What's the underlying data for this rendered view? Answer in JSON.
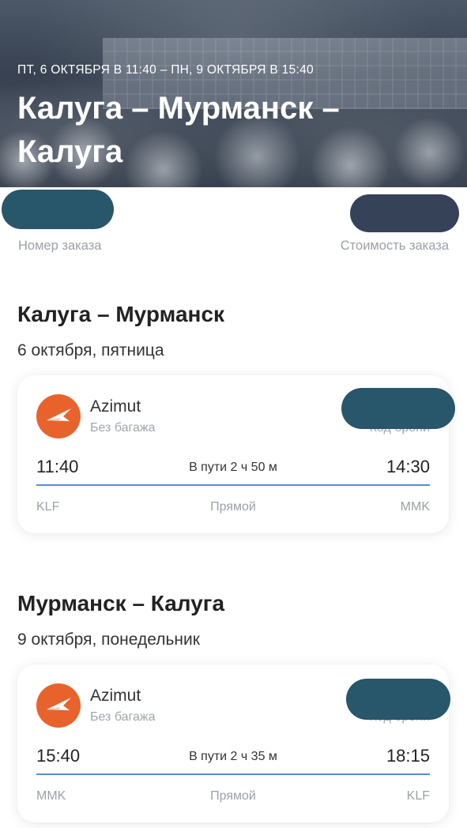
{
  "hero": {
    "dates": "ПТ, 6 ОКТЯБРЯ В 11:40 – ПН, 9 ОКТЯБРЯ В 15:40",
    "title": "Калуга – Мурманск – Калуга"
  },
  "order": {
    "order_number_label": "Номер заказа",
    "cost_label": "Стоимость заказа"
  },
  "segments": [
    {
      "route": "Калуга – Мурманск",
      "date": "6 октября, пятница",
      "airline": "Azimut",
      "baggage": "Без багажа",
      "booking_code_label": "Код брони",
      "departure_time": "11:40",
      "arrival_time": "14:30",
      "duration": "В пути 2 ч 50 м",
      "departure_airport": "KLF",
      "arrival_airport": "MMK",
      "stops": "Прямой"
    },
    {
      "route": "Мурманск – Калуга",
      "date": "9 октября, понедельник",
      "airline": "Azimut",
      "baggage": "Без багажа",
      "booking_code_label": "Код брони",
      "departure_time": "15:40",
      "arrival_time": "18:15",
      "duration": "В пути 2 ч 35 м",
      "departure_airport": "MMK",
      "arrival_airport": "KLF",
      "stops": "Прямой"
    }
  ],
  "icons": {
    "airline_logo": "azimut-logo-icon"
  },
  "colors": {
    "accent_line": "#5a8ad6",
    "airline_logo": "#e8632c",
    "redaction_order": "#28566a",
    "redaction_cost": "#354258"
  }
}
